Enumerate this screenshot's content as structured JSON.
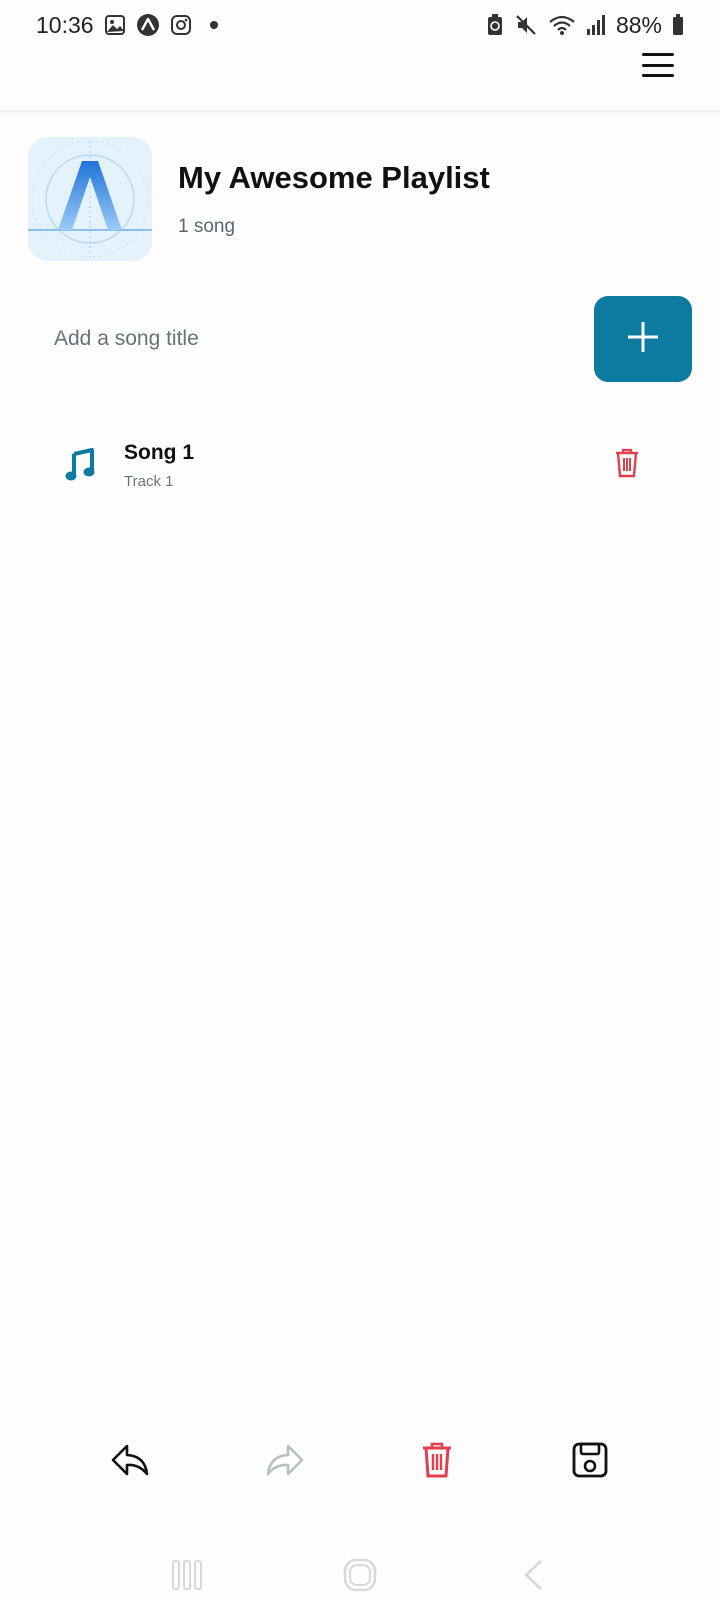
{
  "status_bar": {
    "time": "10:36",
    "battery": "88%",
    "left_icons": [
      "gallery-icon",
      "expo-icon",
      "instagram-icon",
      "notification-dot"
    ],
    "right_icons": [
      "battery-saver-icon",
      "mute-icon",
      "wifi-icon",
      "signal-icon",
      "battery-icon"
    ]
  },
  "header": {
    "menu_icon": "hamburger-menu-icon"
  },
  "playlist": {
    "title": "My Awesome Playlist",
    "count": "1 song"
  },
  "add_song": {
    "placeholder": "Add a song title",
    "value": "",
    "button_icon": "plus-icon"
  },
  "songs": [
    {
      "title": "Song 1",
      "subtitle": "Track 1",
      "icon": "music-note-icon",
      "delete_icon": "trash-icon"
    }
  ],
  "toolbar": {
    "items": [
      "undo-icon",
      "redo-icon",
      "delete-all-icon",
      "save-icon"
    ]
  },
  "colors": {
    "accent": "#0d7aa0",
    "danger": "#e0404e",
    "disabled": "#b9bec3"
  }
}
